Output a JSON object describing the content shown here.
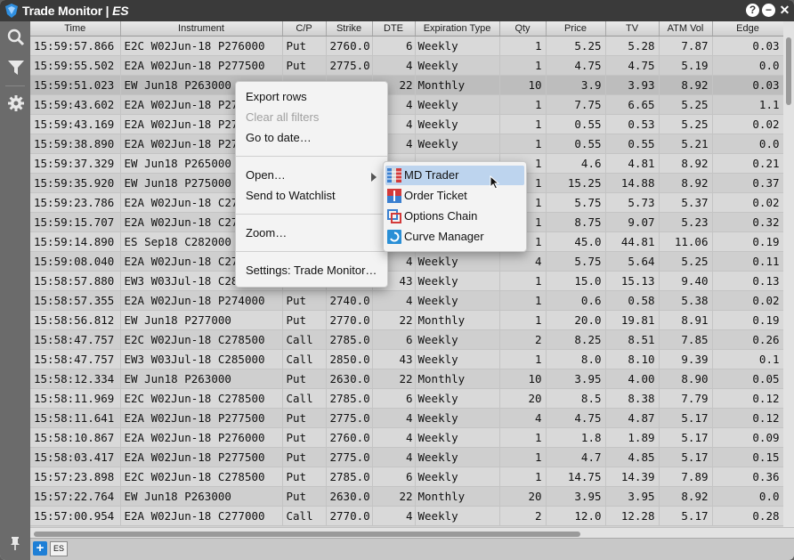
{
  "window": {
    "title": "Trade Monitor",
    "symbol": "ES",
    "colors": {
      "titlebar": "#3a3a3a",
      "accent": "#1e7fd6",
      "highlight": "#bdd4ee"
    }
  },
  "window_buttons": [
    {
      "icon": "help-icon",
      "glyph": "?"
    },
    {
      "icon": "minimize-icon",
      "glyph": "−"
    },
    {
      "icon": "close-icon",
      "glyph": "✕"
    }
  ],
  "sidebar": {
    "icons": [
      "search-icon",
      "filter-icon",
      "gear-icon",
      "pin-icon"
    ]
  },
  "table": {
    "columns": [
      "Time",
      "Instrument",
      "C/P",
      "Strike",
      "DTE",
      "Expiration Type",
      "Qty",
      "Price",
      "TV",
      "ATM Vol",
      "Edge"
    ],
    "rows": [
      [
        "15:59:57.866",
        "E2C W02Jun-18 P276000",
        "Put",
        "2760.0",
        "6",
        "Weekly",
        "1",
        "5.25",
        "5.28",
        "7.87",
        "0.03"
      ],
      [
        "15:59:55.502",
        "E2A W02Jun-18 P277500",
        "Put",
        "2775.0",
        "4",
        "Weekly",
        "1",
        "4.75",
        "4.75",
        "5.19",
        "0.0"
      ],
      [
        "15:59:51.023",
        "EW Jun18 P263000",
        "",
        "",
        "22",
        "Monthly",
        "10",
        "3.9",
        "3.93",
        "8.92",
        "0.03"
      ],
      [
        "15:59:43.602",
        "E2A W02Jun-18 P2780",
        "",
        "",
        "4",
        "Weekly",
        "1",
        "7.75",
        "6.65",
        "5.25",
        "1.1"
      ],
      [
        "15:59:43.169",
        "E2A W02Jun-18 P2740",
        "",
        "",
        "4",
        "Weekly",
        "1",
        "0.55",
        "0.53",
        "5.25",
        "0.02"
      ],
      [
        "15:59:38.890",
        "E2A W02Jun-18 P2740",
        "",
        "",
        "4",
        "Weekly",
        "1",
        "0.55",
        "0.55",
        "5.21",
        "0.0"
      ],
      [
        "15:59:37.329",
        "EW Jun18 P265000",
        "",
        "",
        "",
        "",
        "1",
        "4.6",
        "4.81",
        "8.92",
        "0.21"
      ],
      [
        "15:59:35.920",
        "EW Jun18 P275000",
        "",
        "",
        "",
        "",
        "1",
        "15.25",
        "14.88",
        "8.92",
        "0.37"
      ],
      [
        "15:59:23.786",
        "E2A W02Jun-18 C2780",
        "",
        "",
        "",
        "",
        "1",
        "5.75",
        "5.73",
        "5.37",
        "0.02"
      ],
      [
        "15:59:15.707",
        "E2A W02Jun-18 C2770",
        "",
        "",
        "",
        "",
        "1",
        "8.75",
        "9.07",
        "5.23",
        "0.32"
      ],
      [
        "15:59:14.890",
        "ES Sep18 C282000",
        "",
        "",
        "",
        "",
        "1",
        "45.0",
        "44.81",
        "11.06",
        "0.19"
      ],
      [
        "15:59:08.040",
        "E2A W02Jun-18 C2780",
        "",
        "",
        "4",
        "Weekly",
        "4",
        "5.75",
        "5.64",
        "5.25",
        "0.11"
      ],
      [
        "15:58:57.880",
        "EW3 W03Jul-18 C2825",
        "",
        "",
        "43",
        "Weekly",
        "1",
        "15.0",
        "15.13",
        "9.40",
        "0.13"
      ],
      [
        "15:58:57.355",
        "E2A W02Jun-18 P274000",
        "Put",
        "2740.0",
        "4",
        "Weekly",
        "1",
        "0.6",
        "0.58",
        "5.38",
        "0.02"
      ],
      [
        "15:58:56.812",
        "EW Jun18 P277000",
        "Put",
        "2770.0",
        "22",
        "Monthly",
        "1",
        "20.0",
        "19.81",
        "8.91",
        "0.19"
      ],
      [
        "15:58:47.757",
        "E2C W02Jun-18 C278500",
        "Call",
        "2785.0",
        "6",
        "Weekly",
        "2",
        "8.25",
        "8.51",
        "7.85",
        "0.26"
      ],
      [
        "15:58:47.757",
        "EW3 W03Jul-18 C285000",
        "Call",
        "2850.0",
        "43",
        "Weekly",
        "1",
        "8.0",
        "8.10",
        "9.39",
        "0.1"
      ],
      [
        "15:58:12.334",
        "EW Jun18 P263000",
        "Put",
        "2630.0",
        "22",
        "Monthly",
        "10",
        "3.95",
        "4.00",
        "8.90",
        "0.05"
      ],
      [
        "15:58:11.969",
        "E2C W02Jun-18 C278500",
        "Call",
        "2785.0",
        "6",
        "Weekly",
        "20",
        "8.5",
        "8.38",
        "7.79",
        "0.12"
      ],
      [
        "15:58:11.641",
        "E2A W02Jun-18 P277500",
        "Put",
        "2775.0",
        "4",
        "Weekly",
        "4",
        "4.75",
        "4.87",
        "5.17",
        "0.12"
      ],
      [
        "15:58:10.867",
        "E2A W02Jun-18 P276000",
        "Put",
        "2760.0",
        "4",
        "Weekly",
        "1",
        "1.8",
        "1.89",
        "5.17",
        "0.09"
      ],
      [
        "15:58:03.417",
        "E2A W02Jun-18 P277500",
        "Put",
        "2775.0",
        "4",
        "Weekly",
        "1",
        "4.7",
        "4.85",
        "5.17",
        "0.15"
      ],
      [
        "15:57:23.898",
        "E2C W02Jun-18 C278500",
        "Put",
        "2785.0",
        "6",
        "Weekly",
        "1",
        "14.75",
        "14.39",
        "7.89",
        "0.36"
      ],
      [
        "15:57:22.764",
        "EW Jun18 P263000",
        "Put",
        "2630.0",
        "22",
        "Monthly",
        "20",
        "3.95",
        "3.95",
        "8.92",
        "0.0"
      ],
      [
        "15:57:00.954",
        "E2A W02Jun-18 C277000",
        "Call",
        "2770.0",
        "4",
        "Weekly",
        "2",
        "12.0",
        "12.28",
        "5.17",
        "0.28"
      ]
    ]
  },
  "context_menu": {
    "items": [
      "Export rows",
      "Clear all filters",
      "Go to date…",
      "Open…",
      "Send to Watchlist",
      "Zoom…",
      "Settings: Trade Monitor…"
    ]
  },
  "submenu": {
    "items": [
      {
        "label": "MD Trader",
        "icon": "md-trader-icon"
      },
      {
        "label": "Order Ticket",
        "icon": "order-ticket-icon"
      },
      {
        "label": "Options Chain",
        "icon": "options-chain-icon"
      },
      {
        "label": "Curve Manager",
        "icon": "curve-manager-icon"
      }
    ]
  },
  "tabs": {
    "add_glyph": "+",
    "items": [
      "ES"
    ]
  }
}
